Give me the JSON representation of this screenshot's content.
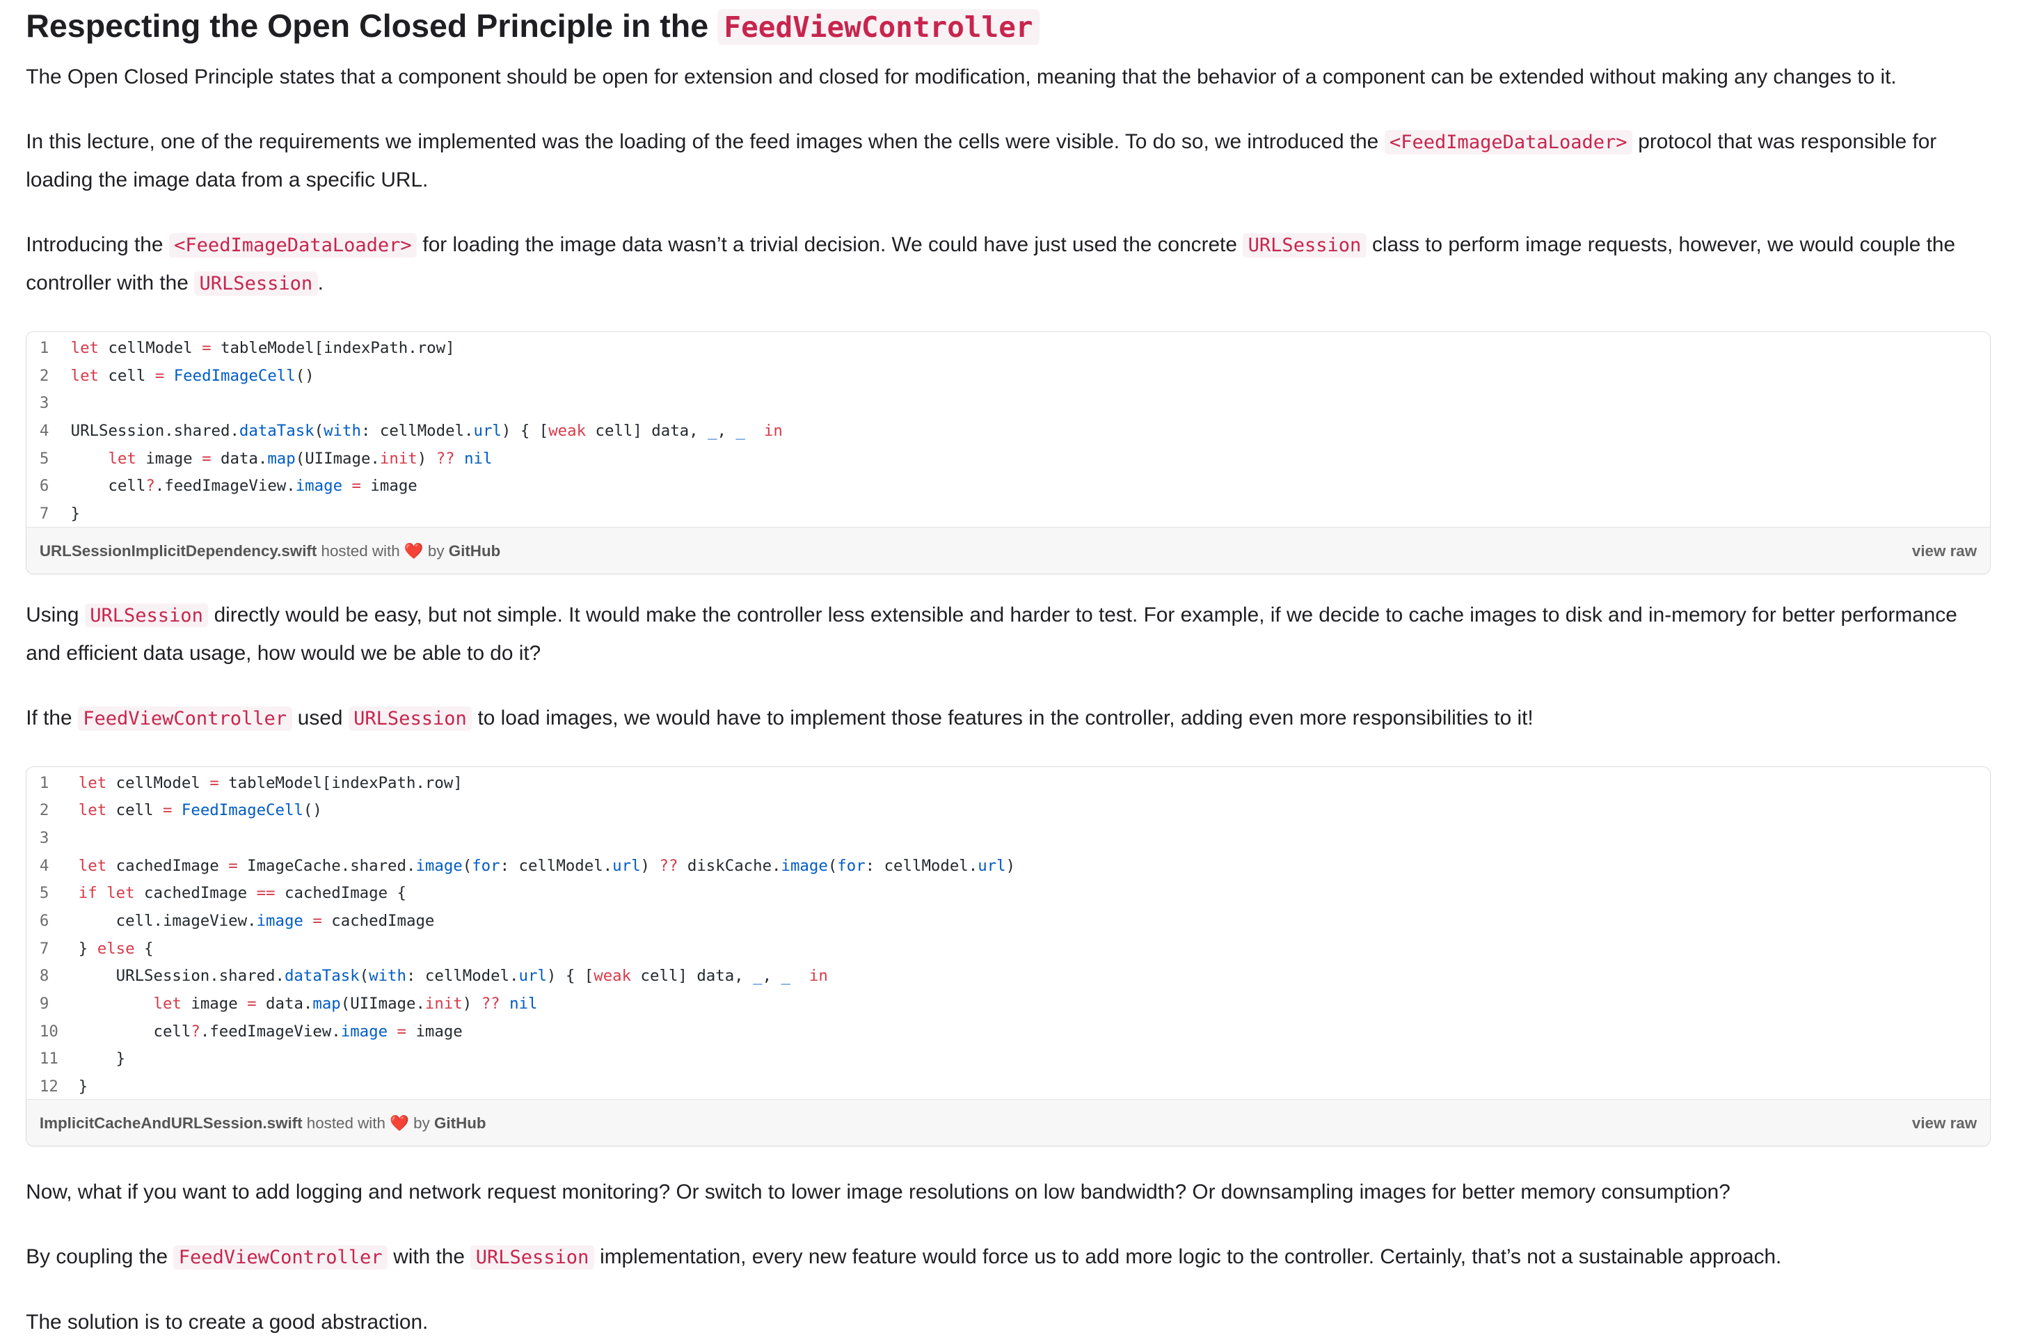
{
  "title": {
    "text": "Respecting the Open Closed Principle in the ",
    "code": "FeedViewController"
  },
  "paragraphs": {
    "p1": "The Open Closed Principle states that a component should be open for extension and closed for modification, meaning that the behavior of a component can be extended without making any changes to it.",
    "p2a": "In this lecture, one of the requirements we implemented was the loading of the feed images when the cells were visible. To do so, we introduced the ",
    "p2code": "<FeedImageDataLoader>",
    "p2b": " protocol that was responsible for loading the image data from a specific URL.",
    "p3a": "Introducing the ",
    "p3code1": "<FeedImageDataLoader>",
    "p3b": " for loading the image data wasn’t a trivial decision. We could have just used the concrete ",
    "p3code2": "URLSession",
    "p3c": " class to perform image requests, however, we would couple the controller with the ",
    "p3code3": "URLSession",
    "p3d": ".",
    "p4a": "Using ",
    "p4code": "URLSession",
    "p4b": " directly would be easy, but not simple. It would make the controller less extensible and harder to test. For example, if we decide to cache images to disk and in-memory for better performance and efficient data usage, how would we be able to do it?",
    "p5a": "If the ",
    "p5code1": "FeedViewController",
    "p5b": " used ",
    "p5code2": "URLSession",
    "p5c": " to load images, we would have to implement those features in the controller, adding even more responsibilities to it!",
    "p6": "Now, what if you want to add logging and network request monitoring? Or switch to lower image resolutions on low bandwidth? Or downsampling images for better memory consumption?",
    "p7a": "By coupling the ",
    "p7code1": "FeedViewController",
    "p7b": " with the ",
    "p7code2": "URLSession",
    "p7c": " implementation, every new feature would force us to add more logic to the controller. Certainly, that’s not a sustainable approach.",
    "p8": "The solution is to create a good abstraction."
  },
  "gist1": {
    "filename": "URLSessionImplicitDependency.swift",
    "hosted": " hosted with ",
    "heart": "❤️",
    "by": " by ",
    "github": "GitHub",
    "view_raw": "view raw",
    "lines": [
      [
        {
          "t": "let",
          "c": "kw"
        },
        {
          "t": " cellModel "
        },
        {
          "t": "=",
          "c": "kw"
        },
        {
          "t": " tableModel[indexPath.row]"
        }
      ],
      [
        {
          "t": "let",
          "c": "kw"
        },
        {
          "t": " cell "
        },
        {
          "t": "=",
          "c": "kw"
        },
        {
          "t": " "
        },
        {
          "t": "FeedImageCell",
          "c": "fn"
        },
        {
          "t": "()"
        }
      ],
      [],
      [
        {
          "t": "URLSession.shared."
        },
        {
          "t": "dataTask",
          "c": "fn"
        },
        {
          "t": "("
        },
        {
          "t": "with",
          "c": "fn"
        },
        {
          "t": ": cellModel."
        },
        {
          "t": "url",
          "c": "fn"
        },
        {
          "t": ") { ["
        },
        {
          "t": "weak",
          "c": "kw"
        },
        {
          "t": " cell] data, "
        },
        {
          "t": "_",
          "c": "fn"
        },
        {
          "t": ", "
        },
        {
          "t": "_",
          "c": "fn"
        },
        {
          "t": "  "
        },
        {
          "t": "in",
          "c": "kw"
        }
      ],
      [
        {
          "t": "    "
        },
        {
          "t": "let",
          "c": "kw"
        },
        {
          "t": " image "
        },
        {
          "t": "=",
          "c": "kw"
        },
        {
          "t": " data."
        },
        {
          "t": "map",
          "c": "fn"
        },
        {
          "t": "(UIImage."
        },
        {
          "t": "init",
          "c": "kw"
        },
        {
          "t": ") "
        },
        {
          "t": "??",
          "c": "kw"
        },
        {
          "t": " "
        },
        {
          "t": "nil",
          "c": "fn"
        }
      ],
      [
        {
          "t": "    cell"
        },
        {
          "t": "?",
          "c": "kw"
        },
        {
          "t": ".feedImageView."
        },
        {
          "t": "image",
          "c": "fn"
        },
        {
          "t": " "
        },
        {
          "t": "=",
          "c": "kw"
        },
        {
          "t": " image"
        }
      ],
      [
        {
          "t": "}"
        }
      ]
    ]
  },
  "gist2": {
    "filename": "ImplicitCacheAndURLSession.swift",
    "hosted": " hosted with ",
    "heart": "❤️",
    "by": " by ",
    "github": "GitHub",
    "view_raw": "view raw",
    "lines": [
      [
        {
          "t": "let",
          "c": "kw"
        },
        {
          "t": " cellModel "
        },
        {
          "t": "=",
          "c": "kw"
        },
        {
          "t": " tableModel[indexPath.row]"
        }
      ],
      [
        {
          "t": "let",
          "c": "kw"
        },
        {
          "t": " cell "
        },
        {
          "t": "=",
          "c": "kw"
        },
        {
          "t": " "
        },
        {
          "t": "FeedImageCell",
          "c": "fn"
        },
        {
          "t": "()"
        }
      ],
      [],
      [
        {
          "t": "let",
          "c": "kw"
        },
        {
          "t": " cachedImage "
        },
        {
          "t": "=",
          "c": "kw"
        },
        {
          "t": " ImageCache.shared."
        },
        {
          "t": "image",
          "c": "fn"
        },
        {
          "t": "("
        },
        {
          "t": "for",
          "c": "fn"
        },
        {
          "t": ": cellModel."
        },
        {
          "t": "url",
          "c": "fn"
        },
        {
          "t": ") "
        },
        {
          "t": "??",
          "c": "kw"
        },
        {
          "t": " diskCache."
        },
        {
          "t": "image",
          "c": "fn"
        },
        {
          "t": "("
        },
        {
          "t": "for",
          "c": "fn"
        },
        {
          "t": ": cellModel."
        },
        {
          "t": "url",
          "c": "fn"
        },
        {
          "t": ")"
        }
      ],
      [
        {
          "t": "if",
          "c": "kw"
        },
        {
          "t": " "
        },
        {
          "t": "let",
          "c": "kw"
        },
        {
          "t": " cachedImage "
        },
        {
          "t": "==",
          "c": "kw"
        },
        {
          "t": " cachedImage {"
        }
      ],
      [
        {
          "t": "    cell.imageView."
        },
        {
          "t": "image",
          "c": "fn"
        },
        {
          "t": " "
        },
        {
          "t": "=",
          "c": "kw"
        },
        {
          "t": " cachedImage"
        }
      ],
      [
        {
          "t": "} "
        },
        {
          "t": "else",
          "c": "kw"
        },
        {
          "t": " {"
        }
      ],
      [
        {
          "t": "    URLSession.shared."
        },
        {
          "t": "dataTask",
          "c": "fn"
        },
        {
          "t": "("
        },
        {
          "t": "with",
          "c": "fn"
        },
        {
          "t": ": cellModel."
        },
        {
          "t": "url",
          "c": "fn"
        },
        {
          "t": ") { ["
        },
        {
          "t": "weak",
          "c": "kw"
        },
        {
          "t": " cell] data, "
        },
        {
          "t": "_",
          "c": "fn"
        },
        {
          "t": ", "
        },
        {
          "t": "_",
          "c": "fn"
        },
        {
          "t": "  "
        },
        {
          "t": "in",
          "c": "kw"
        }
      ],
      [
        {
          "t": "        "
        },
        {
          "t": "let",
          "c": "kw"
        },
        {
          "t": " image "
        },
        {
          "t": "=",
          "c": "kw"
        },
        {
          "t": " data."
        },
        {
          "t": "map",
          "c": "fn"
        },
        {
          "t": "(UIImage."
        },
        {
          "t": "init",
          "c": "kw"
        },
        {
          "t": ") "
        },
        {
          "t": "??",
          "c": "kw"
        },
        {
          "t": " "
        },
        {
          "t": "nil",
          "c": "fn"
        }
      ],
      [
        {
          "t": "        cell"
        },
        {
          "t": "?",
          "c": "kw"
        },
        {
          "t": ".feedImageView."
        },
        {
          "t": "image",
          "c": "fn"
        },
        {
          "t": " "
        },
        {
          "t": "=",
          "c": "kw"
        },
        {
          "t": " image"
        }
      ],
      [
        {
          "t": "    }"
        }
      ],
      [
        {
          "t": "}"
        }
      ]
    ]
  }
}
